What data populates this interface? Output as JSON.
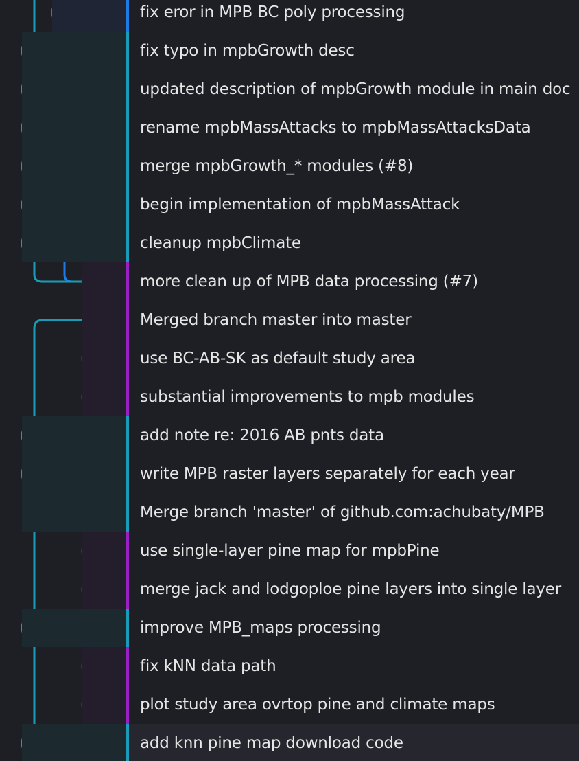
{
  "colors": {
    "background": "#1e1f24",
    "branch_blue": "#1e7ae6",
    "branch_teal": "#1a9bb8",
    "branch_purple": "#9a1fc4",
    "row_highlight": "#25262e"
  },
  "commits": [
    {
      "message": "fix eror in MPB BC poly processing",
      "lane": "blue",
      "merge": false
    },
    {
      "message": "fix typo in mpbGrowth desc",
      "lane": "teal",
      "merge": false
    },
    {
      "message": "updated description of mpbGrowth module in main doc",
      "lane": "teal",
      "merge": false
    },
    {
      "message": "rename mpbMassAttacks to mpbMassAttacksData",
      "lane": "teal",
      "merge": false
    },
    {
      "message": "merge mpbGrowth_* modules (#8)",
      "lane": "teal",
      "merge": false
    },
    {
      "message": "begin implementation of mpbMassAttack",
      "lane": "teal",
      "merge": false
    },
    {
      "message": "cleanup mpbClimate",
      "lane": "teal",
      "merge": false
    },
    {
      "message": "more clean up of MPB data processing (#7)",
      "lane": "purple",
      "merge": false
    },
    {
      "message": "Merged branch master into master",
      "lane": "purple",
      "merge": true
    },
    {
      "message": "use BC-AB-SK as default study area",
      "lane": "purple",
      "merge": false
    },
    {
      "message": "substantial improvements to mpb modules",
      "lane": "purple",
      "merge": false
    },
    {
      "message": "add note re: 2016 AB pnts data",
      "lane": "teal",
      "merge": false
    },
    {
      "message": "write MPB raster layers separately for each year",
      "lane": "teal",
      "merge": false
    },
    {
      "message": "Merge branch 'master' of github.com:achubaty/MPB",
      "lane": "teal",
      "merge": true
    },
    {
      "message": "use single-layer pine map for mpbPine",
      "lane": "purple",
      "merge": false
    },
    {
      "message": "merge jack and lodgoploe pine layers into single layer",
      "lane": "purple",
      "merge": false
    },
    {
      "message": "improve MPB_maps processing",
      "lane": "teal",
      "merge": false
    },
    {
      "message": "fix kNN data path",
      "lane": "purple",
      "merge": false
    },
    {
      "message": "plot study area ovrtop pine and climate maps",
      "lane": "purple",
      "merge": false
    },
    {
      "message": "add knn pine map download code",
      "lane": "teal",
      "merge": false,
      "selected": true
    }
  ]
}
